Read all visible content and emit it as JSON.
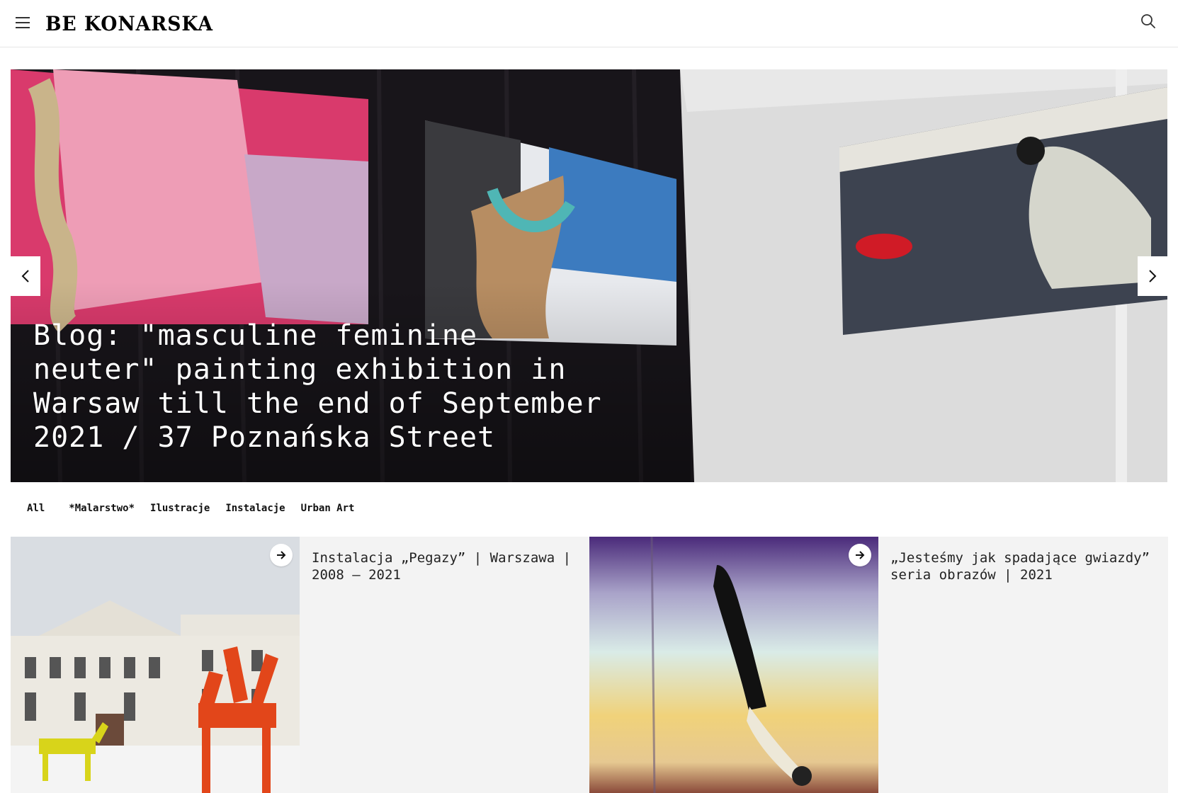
{
  "header": {
    "logo_text": "BE KONARSKA",
    "menu_icon": "hamburger-menu-icon",
    "search_icon": "search-icon"
  },
  "hero": {
    "title": "Blog: \"masculine feminine neuter\" painting exhibition in Warsaw till the end of September 2021 / 37 Poznańska Street",
    "prev_icon": "chevron-left-icon",
    "next_icon": "chevron-right-icon"
  },
  "filters": {
    "items": [
      "All",
      "*Malarstwo*",
      "Ilustracje",
      "Instalacje",
      "Urban Art"
    ]
  },
  "portfolio": {
    "items": [
      {
        "title": "Instalacja „Pegazy” | Warszawa | 2008 – 2021",
        "icon": "arrow-right-icon"
      },
      {
        "title": "„Jesteśmy jak spadające gwiazdy” seria obrazów | 2021",
        "icon": "arrow-right-icon"
      }
    ]
  },
  "colors": {
    "header_border": "#e6e6e6",
    "card_bg": "#f3f3f3",
    "text": "#111111"
  }
}
